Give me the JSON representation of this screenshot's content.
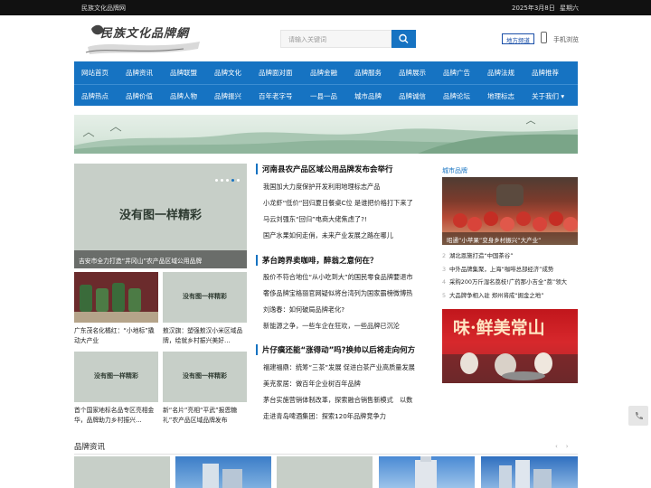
{
  "topbar": {
    "site_name": "民族文化品牌网",
    "date": "2025年3月8日",
    "weekday": "星期六"
  },
  "logo": {
    "title": "民族文化品牌網"
  },
  "search": {
    "placeholder": "请输入关键词",
    "button_icon": "search-icon"
  },
  "header": {
    "region_label": "地方频道",
    "mobile_label": "手机浏览"
  },
  "nav": {
    "row1": [
      "网站首页",
      "品牌资讯",
      "品牌联盟",
      "品牌文化",
      "品牌面对面",
      "品牌金融",
      "品牌服务",
      "品牌展示",
      "品牌广告",
      "品牌法规",
      "品牌推荐"
    ],
    "row2": [
      "品牌热点",
      "品牌价值",
      "品牌人物",
      "品牌振兴",
      "百年老字号",
      "一县一品",
      "城市品牌",
      "品牌诚信",
      "品牌论坛",
      "地理标志",
      "关于我们"
    ]
  },
  "slider": {
    "placeholder": "没有图一样精彩",
    "caption": "吉安市全力打造“井冈山”农产品区域公用品牌"
  },
  "thumbs": [
    {
      "placeholder": "",
      "caption": "广东茂名化橘红：“小地标”撬动大产业"
    },
    {
      "placeholder": "没有图一样精彩",
      "caption": "敖汉旗：塑强敖汉小米区域品牌，绘就乡村振兴美好…"
    },
    {
      "placeholder": "没有图一样精彩",
      "caption": "首个国家地标名品专区亮相金华，品牌助力乡村振兴…"
    },
    {
      "placeholder": "没有图一样精彩",
      "caption": "新“名片”亮相“平武”报恩糖礼”农产品区域品牌发布"
    }
  ],
  "news": [
    {
      "headline": "河南县农产品区域公用品牌发布会举行",
      "items": [
        "我国加大力度保护开发利用地理标志产品",
        "小龙虾“低价”回归夏日餐桌C位 是谁把价格打下来了",
        "马云刘强东“回归”电商大佬焦虑了?!",
        "国产水果如何走俏，未来产业发展之路在哪儿"
      ]
    },
    {
      "headline": "茅台跨界卖咖啡，醉翁之意何在？",
      "items": [
        "股价不符合地位“从小吃到大”的国民零食品牌要退市",
        "奢侈品牌宝格丽官网疑似将台湾列为国家霸榜微博热",
        "刘逸春：如何破局品牌老化?",
        "新能源之争，一些车企在狂欢，一些品牌已沉沦"
      ]
    },
    {
      "headline": "片仔癀还能“涨得动”吗?换帅以后将走向何方",
      "items": [
        "福建福鼎：统筹“三茶”发展 促进白茶产业高质量发展",
        "美克家居：做百年企业树百年品牌",
        "茅台实施营销体制改革，探索融合销售新模式　以数",
        "走进青岛啤酒集团：探索120年品牌竞争力"
      ]
    }
  ],
  "right": {
    "category": "城市品牌",
    "photo1_caption": "昭通“小苹果”变身乡村振兴“大产业”",
    "list": [
      {
        "num": "2",
        "text": "湖北恩施打造“中国茶谷”"
      },
      {
        "num": "3",
        "text": "中外品牌集聚，上海“咖啡总部经济”成势"
      },
      {
        "num": "4",
        "text": "采购200万斤湿名荔枝!广药那小吉全“荔”领大"
      },
      {
        "num": "5",
        "text": "大品牌争相入驻 郑州将成“掘金之地”"
      }
    ],
    "photo2_text": "味·鲜美常山"
  },
  "section": {
    "title": "品牌资讯",
    "prev": "‹",
    "next": "›"
  },
  "colors": {
    "brand": "#1673c2",
    "topbar": "#111111"
  }
}
